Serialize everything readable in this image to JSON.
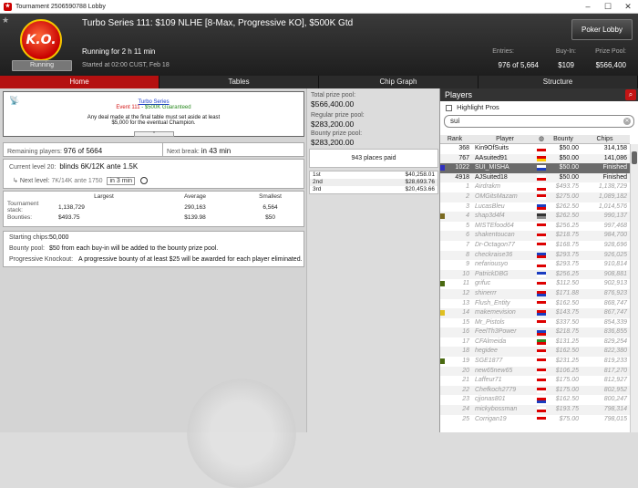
{
  "window": {
    "title": "Tournament 2506590788 Lobby",
    "app_icon": "pokerstars-icon"
  },
  "header": {
    "logo_text": "K.O.",
    "status_badge": "Running",
    "title": "Turbo Series 111: $109 NLHE [8-Max, Progressive KO], $500K Gtd",
    "running_for": "Running for 2 h 11 min",
    "started": "Started at 02:00 CUST, Feb 18",
    "lobby_button": "Poker Lobby",
    "entries_label": "Entries:",
    "entries_value": "976 of 5,664",
    "buyin_label": "Buy-In:",
    "buyin_value": "$109",
    "prize_label": "Prize Pool:",
    "prize_value": "$566,400"
  },
  "tabs": [
    {
      "label": "Home",
      "active": true
    },
    {
      "label": "Tables",
      "active": false
    },
    {
      "label": "Chip Graph",
      "active": false
    },
    {
      "label": "Structure",
      "active": false
    }
  ],
  "info": {
    "line1": "Turbo Series",
    "line2_event": "Event 111",
    "line2_gtd": " - $500K Guaranteed",
    "line3a": "Any deal made at the final table must set aside at least",
    "line3b": "$5,000 for the eventual Champion."
  },
  "remaining": {
    "label": "Remaining players:",
    "value": "976 of 5664",
    "break_label": "Next break:",
    "break_value": "in 43 min"
  },
  "level": {
    "current_label": "Current level 20:",
    "current_value": "blinds 6K/12K ante 1.5K",
    "next_label": "Next level:",
    "next_value": "7K/14K ante 1750",
    "next_in": "in 3 min"
  },
  "stack_table": {
    "headers": [
      "Largest",
      "Average",
      "Smallest"
    ],
    "stack_label": "Tournament stack:",
    "stack_values": [
      "1,138,729",
      "290,163",
      "6,564"
    ],
    "bounty_label": "Bounties:",
    "bounty_values": [
      "$493.75",
      "$139.98",
      "$50"
    ]
  },
  "prize_info": {
    "starting_label": "Starting chips:",
    "starting_value": "50,000",
    "bounty_pool_label": "Bounty pool:",
    "bounty_pool_value": "$50 from each buy-in will be added to the bounty prize pool.",
    "pko_label": "Progressive Knockout:",
    "pko_value": "A progressive bounty of at least $25 will be awarded for each player eliminated."
  },
  "prizes": {
    "total_label": "Total prize pool:",
    "total_value": "$566,400.00",
    "regular_label": "Regular prize pool:",
    "regular_value": "$283,200.00",
    "bounty_label": "Bounty prize pool:",
    "bounty_value": "$283,200.00",
    "places_paid": "943 places paid",
    "places": [
      {
        "place": "1st",
        "amount": "$40,258.01"
      },
      {
        "place": "2nd",
        "amount": "$28,693.76"
      },
      {
        "place": "3rd",
        "amount": "$20,453.66"
      }
    ]
  },
  "players": {
    "title": "Players",
    "highlight_label": "Highlight Pros",
    "search_value": "sui",
    "headers": {
      "rank": "Rank",
      "player": "Player",
      "bounty": "Bounty",
      "chips": "Chips"
    },
    "rows": [
      {
        "rank": "368",
        "name": "Kin9OfSuits",
        "flag": [
          "#fff",
          "#d00"
        ],
        "bounty": "$50.00",
        "chips": "314,158",
        "state": "normal",
        "mark": ""
      },
      {
        "rank": "767",
        "name": "AAsuited91",
        "flag": [
          "#d00",
          "#fc0"
        ],
        "bounty": "$50.00",
        "chips": "141,086",
        "state": "normal",
        "mark": ""
      },
      {
        "rank": "1022",
        "name": "SUI_MISHA",
        "flag": [
          "#fff",
          "#1a3cc0"
        ],
        "bounty": "$50.00",
        "chips": "Finished",
        "state": "sel",
        "mark": "#3030c0"
      },
      {
        "rank": "4918",
        "name": "AJSuited18",
        "flag": [
          "#fff",
          "#d00"
        ],
        "bounty": "$50.00",
        "chips": "Finished",
        "state": "normal",
        "mark": ""
      },
      {
        "rank": "1",
        "name": "Airdrakm",
        "flag": [
          "#fff",
          "#d00"
        ],
        "bounty": "$493.75",
        "chips": "1,138,729",
        "state": "dim",
        "mark": ""
      },
      {
        "rank": "2",
        "name": "OMGitsMazam",
        "flag": [
          "#d00",
          "#fff"
        ],
        "bounty": "$275.00",
        "chips": "1,089,182",
        "state": "dim",
        "mark": ""
      },
      {
        "rank": "3",
        "name": "LucasBleu",
        "flag": [
          "#1a3cc0",
          "#d00"
        ],
        "bounty": "$262.50",
        "chips": "1,014,576",
        "state": "dim",
        "mark": ""
      },
      {
        "rank": "4",
        "name": "shap3d4f4",
        "flag": [
          "#333",
          "#888"
        ],
        "bounty": "$262.50",
        "chips": "990,137",
        "state": "dim",
        "mark": "#7a6a20"
      },
      {
        "rank": "5",
        "name": "MISTEfood64",
        "flag": [
          "#d00",
          "#fff"
        ],
        "bounty": "$256.25",
        "chips": "997,468",
        "state": "dim",
        "mark": ""
      },
      {
        "rank": "6",
        "name": "shakentoucan",
        "flag": [
          "#d00",
          "#fff"
        ],
        "bounty": "$218.75",
        "chips": "984,700",
        "state": "dim",
        "mark": ""
      },
      {
        "rank": "7",
        "name": "Dr-Octagon77",
        "flag": [
          "#d00",
          "#fff"
        ],
        "bounty": "$168.75",
        "chips": "928,696",
        "state": "dim",
        "mark": ""
      },
      {
        "rank": "8",
        "name": "checkraise36",
        "flag": [
          "#1a3cc0",
          "#d00"
        ],
        "bounty": "$293.75",
        "chips": "926,025",
        "state": "dim",
        "mark": ""
      },
      {
        "rank": "9",
        "name": "nefariousyo",
        "flag": [
          "#fff",
          "#d00"
        ],
        "bounty": "$293.75",
        "chips": "910,814",
        "state": "dim",
        "mark": ""
      },
      {
        "rank": "10",
        "name": "PatrickDBG",
        "flag": [
          "#1a3cc0",
          "#fff"
        ],
        "bounty": "$256.25",
        "chips": "908,881",
        "state": "dim",
        "mark": ""
      },
      {
        "rank": "11",
        "name": "grifuc",
        "flag": [
          "#d00",
          "#fff"
        ],
        "bounty": "$112.50",
        "chips": "902,913",
        "state": "dim",
        "mark": "#4a6a10"
      },
      {
        "rank": "12",
        "name": "shinerrr",
        "flag": [
          "#d00",
          "#1a3cc0"
        ],
        "bounty": "$171.88",
        "chips": "876,923",
        "state": "dim",
        "mark": ""
      },
      {
        "rank": "13",
        "name": "Flush_Entity",
        "flag": [
          "#d00",
          "#fff"
        ],
        "bounty": "$162.50",
        "chips": "868,747",
        "state": "dim",
        "mark": ""
      },
      {
        "rank": "14",
        "name": "makemevision",
        "flag": [
          "#d00",
          "#1a3cc0"
        ],
        "bounty": "$143.75",
        "chips": "867,747",
        "state": "dim",
        "mark": "#e0c020"
      },
      {
        "rank": "15",
        "name": "Mr_Pistols",
        "flag": [
          "#d00",
          "#fff"
        ],
        "bounty": "$337.50",
        "chips": "854,339",
        "state": "dim",
        "mark": ""
      },
      {
        "rank": "16",
        "name": "FeelTh3Power",
        "flag": [
          "#1a3cc0",
          "#d00"
        ],
        "bounty": "$218.75",
        "chips": "836,855",
        "state": "dim",
        "mark": ""
      },
      {
        "rank": "17",
        "name": "CFAlmeida",
        "flag": [
          "#2a8a20",
          "#d00"
        ],
        "bounty": "$131.25",
        "chips": "829,254",
        "state": "dim",
        "mark": ""
      },
      {
        "rank": "18",
        "name": "hegidee",
        "flag": [
          "#d00",
          "#fff"
        ],
        "bounty": "$162.50",
        "chips": "822,380",
        "state": "dim",
        "mark": ""
      },
      {
        "rank": "19",
        "name": "SGE1877",
        "flag": [
          "#d00",
          "#fff"
        ],
        "bounty": "$231.25",
        "chips": "819,233",
        "state": "dim",
        "mark": "#4a6a10"
      },
      {
        "rank": "20",
        "name": "new65new65",
        "flag": [
          "#d00",
          "#fff"
        ],
        "bounty": "$106.25",
        "chips": "817,270",
        "state": "dim",
        "mark": ""
      },
      {
        "rank": "21",
        "name": "Laffeur71",
        "flag": [
          "#d00",
          "#fff"
        ],
        "bounty": "$175.00",
        "chips": "812,927",
        "state": "dim",
        "mark": ""
      },
      {
        "rank": "22",
        "name": "Chefkoch2779",
        "flag": [
          "#d00",
          "#fff"
        ],
        "bounty": "$175.00",
        "chips": "802,952",
        "state": "dim",
        "mark": ""
      },
      {
        "rank": "23",
        "name": "cjjonas801",
        "flag": [
          "#d00",
          "#1a3cc0"
        ],
        "bounty": "$162.50",
        "chips": "800,247",
        "state": "dim",
        "mark": ""
      },
      {
        "rank": "24",
        "name": "mickybossman",
        "flag": [
          "#fff",
          "#d00"
        ],
        "bounty": "$193.75",
        "chips": "798,314",
        "state": "dim",
        "mark": ""
      },
      {
        "rank": "25",
        "name": "Corrigan19",
        "flag": [
          "#d00",
          "#fff"
        ],
        "bounty": "$75.00",
        "chips": "798,015",
        "state": "dim",
        "mark": ""
      }
    ]
  },
  "colors": {
    "accent_red": "#b41010",
    "header_dark": "#2b2b2b"
  }
}
